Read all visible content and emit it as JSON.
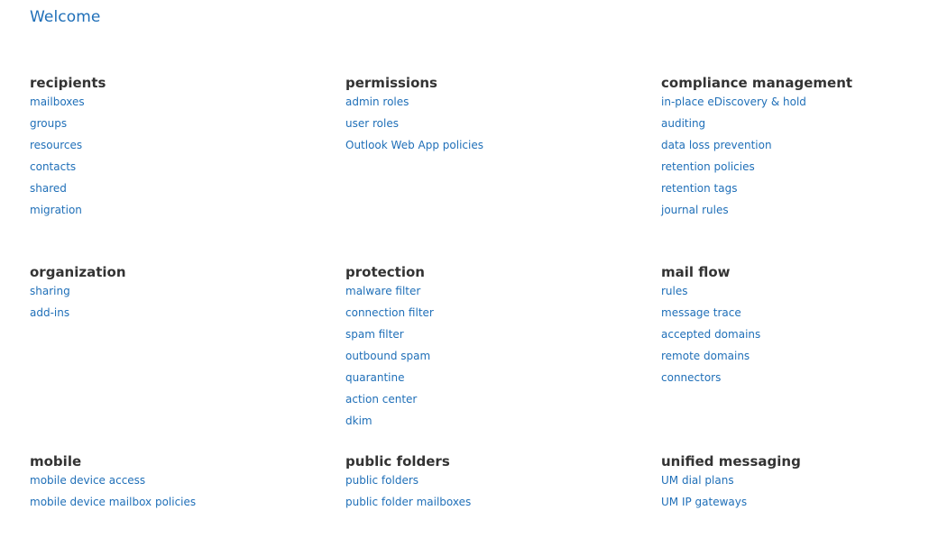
{
  "page": {
    "title": "Welcome"
  },
  "sections": [
    {
      "title": "recipients",
      "links": [
        "mailboxes",
        "groups",
        "resources",
        "contacts",
        "shared",
        "migration"
      ]
    },
    {
      "title": "permissions",
      "links": [
        "admin roles",
        "user roles",
        "Outlook Web App policies"
      ]
    },
    {
      "title": "compliance management",
      "links": [
        "in-place eDiscovery & hold",
        "auditing",
        "data loss prevention",
        "retention policies",
        "retention tags",
        "journal rules"
      ]
    },
    {
      "title": "organization",
      "links": [
        "sharing",
        "add-ins"
      ]
    },
    {
      "title": "protection",
      "links": [
        "malware filter",
        "connection filter",
        "spam filter",
        "outbound spam",
        "quarantine",
        "action center",
        "dkim"
      ]
    },
    {
      "title": "mail flow",
      "links": [
        "rules",
        "message trace",
        "accepted domains",
        "remote domains",
        "connectors"
      ]
    },
    {
      "title": "mobile",
      "links": [
        "mobile device access",
        "mobile device mailbox policies"
      ]
    },
    {
      "title": "public folders",
      "links": [
        "public folders",
        "public folder mailboxes"
      ]
    },
    {
      "title": "unified messaging",
      "links": [
        "UM dial plans",
        "UM IP gateways"
      ]
    }
  ],
  "colors": {
    "link": "#1f6fb8",
    "heading": "#333333",
    "background": "#ffffff"
  }
}
